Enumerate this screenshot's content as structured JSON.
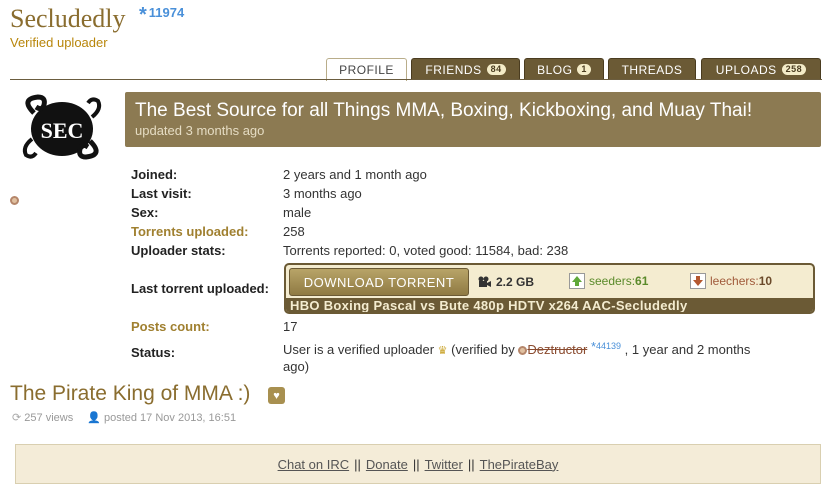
{
  "profile": {
    "username": "Secludedly",
    "reputation": "11974",
    "reputation_icon": "star-icon",
    "role": "Verified uploader"
  },
  "tabs": [
    {
      "label": "PROFILE",
      "badge": ""
    },
    {
      "label": "FRIENDS",
      "badge": "84"
    },
    {
      "label": "BLOG",
      "badge": "1"
    },
    {
      "label": "THREADS",
      "badge": ""
    },
    {
      "label": "UPLOADS",
      "badge": "258"
    }
  ],
  "banner": {
    "title": "The Best Source for all Things MMA, Boxing, Kickboxing, and Muay Thai!",
    "subtitle": "updated 3 months ago"
  },
  "details": {
    "joined_label": "Joined:",
    "joined": "2 years and 1 month ago",
    "last_visit_label": "Last visit:",
    "last_visit": "3 months ago",
    "sex_label": "Sex:",
    "sex": "male",
    "torrents_label": "Torrents uploaded:",
    "torrents": "258",
    "stats_label": "Uploader stats:",
    "stats": "Torrents reported: 0, voted good: 11584, bad: 238",
    "last_torrent_label": "Last torrent uploaded:",
    "posts_label": "Posts count:",
    "posts": "17",
    "status_label": "Status:"
  },
  "last_torrent": {
    "download_label": "DOWNLOAD TORRENT",
    "size": "2.2 GB",
    "seeders_label": "seeders:",
    "seeders": "61",
    "leechers_label": "leechers:",
    "leechers": "10",
    "name": "HBO Boxing Pascal vs Bute 480p HDTV x264 AAC-Secludedly"
  },
  "status": {
    "text": "User is a verified uploader",
    "verified_by_prefix": "(verified by",
    "verifier": "Deztructor",
    "verifier_rep": "44139",
    "verified_suffix": ", 1 year and 2 months ago)"
  },
  "post": {
    "title": "The Pirate King of MMA :)",
    "views": "257 views",
    "posted": "posted 17 Nov 2013, 16:51"
  },
  "footer": {
    "links": [
      "Chat on IRC",
      "Donate",
      "Twitter",
      "ThePirateBay"
    ],
    "separator": "||"
  },
  "colors": {
    "accent": "#8a6d2f",
    "tab_dark": "#6b5a35",
    "banner": "#8c7a52",
    "rep_blue": "#4a90d9"
  }
}
